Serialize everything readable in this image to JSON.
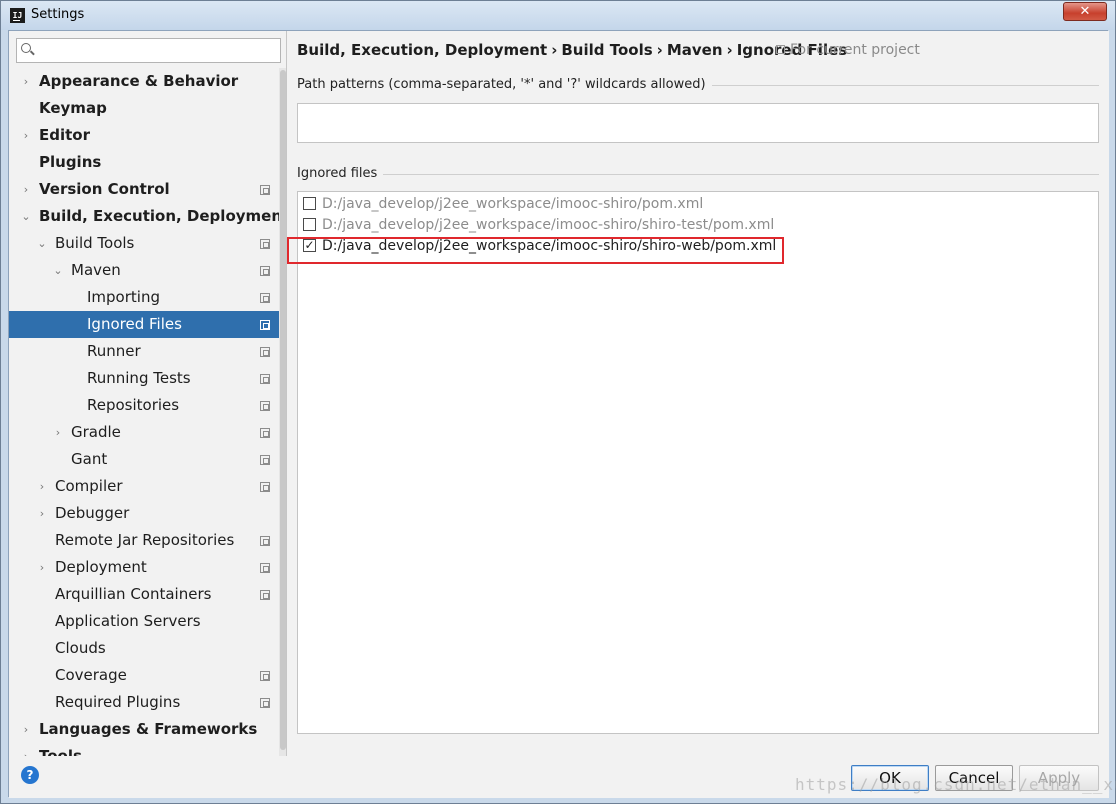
{
  "window": {
    "title": "Settings",
    "app_icon_text": "IJ",
    "close_glyph": "✕"
  },
  "sidebar": {
    "search_placeholder": "",
    "items": [
      {
        "label": "Appearance & Behavior",
        "expander": "›",
        "bold": true,
        "project_icon": false
      },
      {
        "label": "Keymap",
        "expander": "",
        "bold": true,
        "project_icon": false
      },
      {
        "label": "Editor",
        "expander": "›",
        "bold": true,
        "project_icon": false
      },
      {
        "label": "Plugins",
        "expander": "",
        "bold": true,
        "project_icon": false
      },
      {
        "label": "Version Control",
        "expander": "›",
        "bold": true,
        "project_icon": true
      },
      {
        "label": "Build, Execution, Deployment",
        "expander": "⌄",
        "bold": true,
        "project_icon": false
      },
      {
        "label": "Build Tools",
        "expander": "⌄",
        "bold": false,
        "project_icon": true
      },
      {
        "label": "Maven",
        "expander": "⌄",
        "bold": false,
        "project_icon": true
      },
      {
        "label": "Importing",
        "expander": "",
        "bold": false,
        "project_icon": true
      },
      {
        "label": "Ignored Files",
        "expander": "",
        "bold": false,
        "project_icon": true,
        "selected": true
      },
      {
        "label": "Runner",
        "expander": "",
        "bold": false,
        "project_icon": true
      },
      {
        "label": "Running Tests",
        "expander": "",
        "bold": false,
        "project_icon": true
      },
      {
        "label": "Repositories",
        "expander": "",
        "bold": false,
        "project_icon": true
      },
      {
        "label": "Gradle",
        "expander": "›",
        "bold": false,
        "project_icon": true
      },
      {
        "label": "Gant",
        "expander": "",
        "bold": false,
        "project_icon": true
      },
      {
        "label": "Compiler",
        "expander": "›",
        "bold": false,
        "project_icon": true
      },
      {
        "label": "Debugger",
        "expander": "›",
        "bold": false,
        "project_icon": false
      },
      {
        "label": "Remote Jar Repositories",
        "expander": "",
        "bold": false,
        "project_icon": true
      },
      {
        "label": "Deployment",
        "expander": "›",
        "bold": false,
        "project_icon": true
      },
      {
        "label": "Arquillian Containers",
        "expander": "",
        "bold": false,
        "project_icon": true
      },
      {
        "label": "Application Servers",
        "expander": "",
        "bold": false,
        "project_icon": false
      },
      {
        "label": "Clouds",
        "expander": "",
        "bold": false,
        "project_icon": false
      },
      {
        "label": "Coverage",
        "expander": "",
        "bold": false,
        "project_icon": true
      },
      {
        "label": "Required Plugins",
        "expander": "",
        "bold": false,
        "project_icon": true
      },
      {
        "label": "Languages & Frameworks",
        "expander": "›",
        "bold": true,
        "project_icon": false
      },
      {
        "label": "Tools",
        "expander": "›",
        "bold": true,
        "project_icon": false
      }
    ]
  },
  "content": {
    "breadcrumb": [
      "Build, Execution, Deployment",
      "Build Tools",
      "Maven",
      "Ignored Files"
    ],
    "breadcrumb_separator": "›",
    "scope_note": "For current project",
    "path_patterns_label": "Path patterns (comma-separated, '*' and '?' wildcards allowed)",
    "path_patterns_value": "",
    "ignored_files_label": "Ignored files",
    "ignored_files": [
      {
        "path": "D:/java_develop/j2ee_workspace/imooc-shiro/pom.xml",
        "checked": false
      },
      {
        "path": "D:/java_develop/j2ee_workspace/imooc-shiro/shiro-test/pom.xml",
        "checked": false
      },
      {
        "path": "D:/java_develop/j2ee_workspace/imooc-shiro/shiro-web/pom.xml",
        "checked": true
      }
    ]
  },
  "footer": {
    "help_glyph": "?",
    "ok_label": "OK",
    "cancel_label": "Cancel",
    "apply_label": "Apply",
    "watermark": "https://blog.csdn.net/ethan__xu"
  },
  "colors": {
    "selection": "#2f6fad",
    "highlight_box": "#e0282d",
    "help_icon": "#2676d0"
  }
}
